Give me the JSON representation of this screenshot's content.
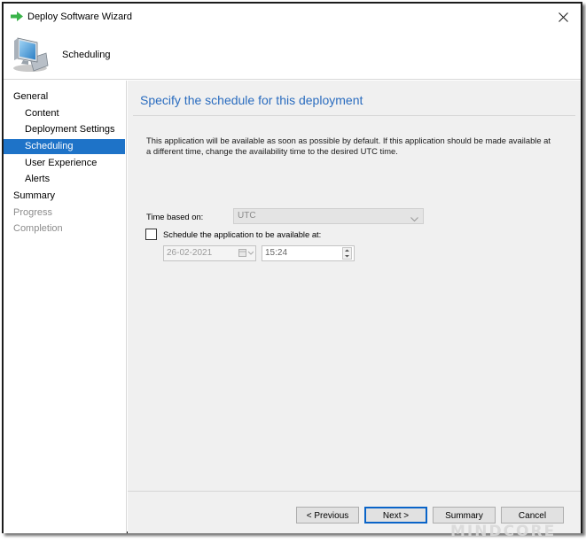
{
  "window": {
    "title": "Deploy Software Wizard",
    "header_title": "Scheduling",
    "close_icon": "close-icon",
    "arrow_icon": "green-arrow-icon"
  },
  "sidebar": {
    "items": [
      {
        "label": "General",
        "state": "normal"
      },
      {
        "label": "Content",
        "state": "normal"
      },
      {
        "label": "Deployment Settings",
        "state": "normal"
      },
      {
        "label": "Scheduling",
        "state": "selected"
      },
      {
        "label": "User Experience",
        "state": "normal"
      },
      {
        "label": "Alerts",
        "state": "normal"
      },
      {
        "label": "Summary",
        "state": "normal"
      },
      {
        "label": "Progress",
        "state": "disabled"
      },
      {
        "label": "Completion",
        "state": "disabled"
      }
    ]
  },
  "main": {
    "heading": "Specify the schedule for this deployment",
    "description": "This application will be available as soon as possible by default. If this application should be made available at a different time, change the availability time to the desired UTC time.",
    "time_based_on_label": "Time based on:",
    "time_based_on_value": "UTC",
    "schedule_checkbox_label": "Schedule the application to be available at:",
    "schedule_checked": false,
    "date_value": "26-02-2021",
    "time_value": "15:24"
  },
  "buttons": {
    "previous": "< Previous",
    "next": "Next >",
    "summary": "Summary",
    "cancel": "Cancel"
  },
  "colors": {
    "accent": "#1e73c8",
    "heading": "#2a6cbf",
    "arrow_green": "#3ab34a"
  },
  "watermark": "MINDCORE"
}
